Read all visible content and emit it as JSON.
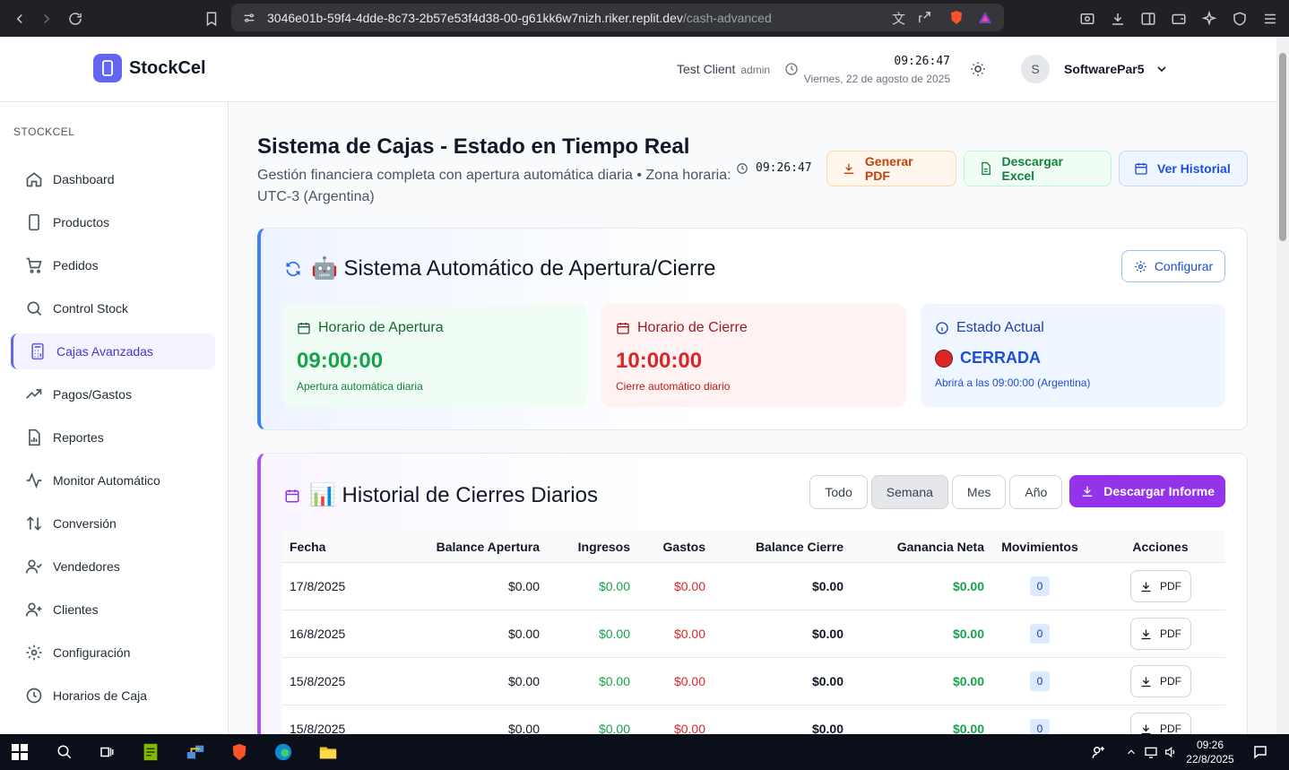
{
  "browser": {
    "url_host": "3046e01b-59f4-4dde-8c73-2b57e53f4d38-00-g61kk6w7nizh.riker.replit.dev",
    "url_path": "/cash-advanced"
  },
  "header": {
    "app_name": "StockCel",
    "client_name": "Test Client",
    "client_role": "admin",
    "time": "09:26:47",
    "date": "Viernes, 22 de agosto de 2025",
    "user_initial": "S",
    "user_name": "SoftwarePar5"
  },
  "sidebar": {
    "title": "STOCKCEL",
    "items": [
      {
        "label": "Dashboard",
        "icon": "home-icon"
      },
      {
        "label": "Productos",
        "icon": "phone-icon"
      },
      {
        "label": "Pedidos",
        "icon": "cart-icon"
      },
      {
        "label": "Control Stock",
        "icon": "search-icon"
      },
      {
        "label": "Cajas Avanzadas",
        "icon": "calculator-icon",
        "active": true
      },
      {
        "label": "Pagos/Gastos",
        "icon": "trending-up-icon"
      },
      {
        "label": "Reportes",
        "icon": "report-icon"
      },
      {
        "label": "Monitor Automático",
        "icon": "activity-icon"
      },
      {
        "label": "Conversión",
        "icon": "arrows-up-down-icon"
      },
      {
        "label": "Vendedores",
        "icon": "user-check-icon"
      },
      {
        "label": "Clientes",
        "icon": "user-plus-icon"
      },
      {
        "label": "Configuración",
        "icon": "gear-icon"
      },
      {
        "label": "Horarios de Caja",
        "icon": "clock-icon"
      }
    ]
  },
  "page": {
    "title": "Sistema de Cajas - Estado en Tiempo Real",
    "subtitle": "Gestión financiera completa con apertura automática diaria • Zona horaria: UTC-3 (Argentina)",
    "time": "09:26:47",
    "buttons": {
      "pdf": "Generar PDF",
      "excel": "Descargar Excel",
      "history": "Ver Historial"
    }
  },
  "auto_system": {
    "title": "🤖 Sistema Automático de Apertura/Cierre",
    "config_label": "Configurar",
    "open": {
      "label": "Horario de Apertura",
      "time": "09:00:00",
      "note": "Apertura automática diaria"
    },
    "close": {
      "label": "Horario de Cierre",
      "time": "10:00:00",
      "note": "Cierre automático diario"
    },
    "state": {
      "label": "Estado Actual",
      "value": "CERRADA",
      "note": "Abrirá a las 09:00:00 (Argentina)"
    }
  },
  "history": {
    "title": "📊 Historial de Cierres Diarios",
    "filters": [
      "Todo",
      "Semana",
      "Mes",
      "Año"
    ],
    "active_filter": "Semana",
    "download_label": "Descargar Informe",
    "columns": [
      "Fecha",
      "Balance Apertura",
      "Ingresos",
      "Gastos",
      "Balance Cierre",
      "Ganancia Neta",
      "Movimientos",
      "Acciones"
    ],
    "rows": [
      {
        "fecha": "17/8/2025",
        "balance_apertura": "$0.00",
        "ingresos": "$0.00",
        "gastos": "$0.00",
        "balance_cierre": "$0.00",
        "ganancia_neta": "$0.00",
        "movimientos": "0",
        "accion": "PDF"
      },
      {
        "fecha": "16/8/2025",
        "balance_apertura": "$0.00",
        "ingresos": "$0.00",
        "gastos": "$0.00",
        "balance_cierre": "$0.00",
        "ganancia_neta": "$0.00",
        "movimientos": "0",
        "accion": "PDF"
      },
      {
        "fecha": "15/8/2025",
        "balance_apertura": "$0.00",
        "ingresos": "$0.00",
        "gastos": "$0.00",
        "balance_cierre": "$0.00",
        "ganancia_neta": "$0.00",
        "movimientos": "0",
        "accion": "PDF"
      },
      {
        "fecha": "15/8/2025",
        "balance_apertura": "$0.00",
        "ingresos": "$0.00",
        "gastos": "$0.00",
        "balance_cierre": "$0.00",
        "ganancia_neta": "$0.00",
        "movimientos": "0",
        "accion": "PDF"
      }
    ]
  },
  "taskbar": {
    "time": "09:26",
    "date": "22/8/2025"
  }
}
